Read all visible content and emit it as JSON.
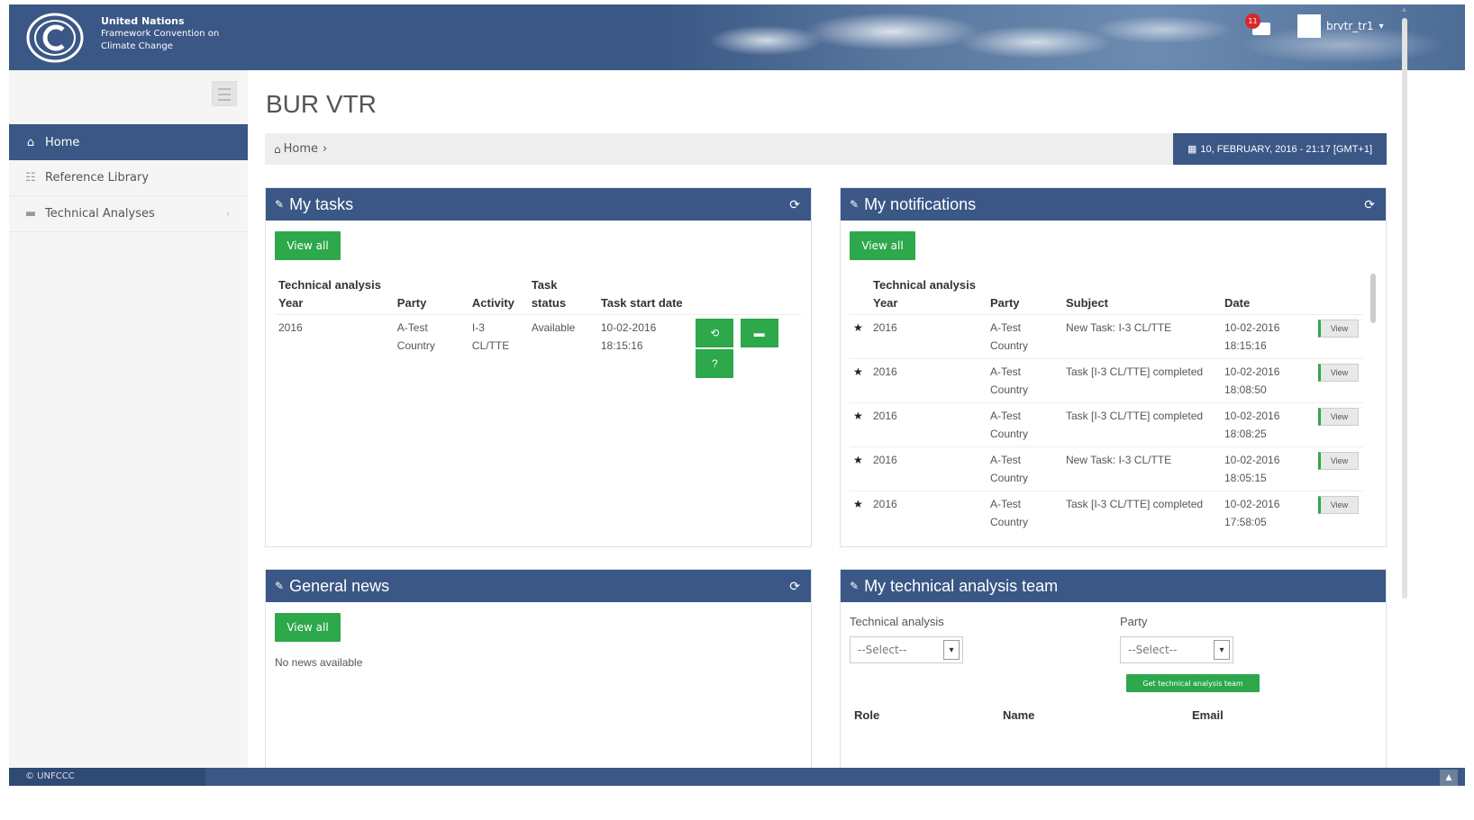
{
  "header": {
    "org_line1": "United Nations",
    "org_line2": "Framework Convention on",
    "org_line3": "Climate Change",
    "notification_count": "11",
    "username": "brvtr_tr1"
  },
  "sidebar": {
    "items": [
      {
        "label": "Home",
        "icon": "home-icon"
      },
      {
        "label": "Reference Library",
        "icon": "list-icon"
      },
      {
        "label": "Technical Analyses",
        "icon": "folder-icon"
      }
    ]
  },
  "main": {
    "title": "BUR VTR",
    "breadcrumb": "Home",
    "datetime": "10, FEBRUARY, 2016 - 21:17 [GMT+1]"
  },
  "my_tasks": {
    "title": "My tasks",
    "view_all": "View all",
    "headers": [
      "Technical analysis Year",
      "Party",
      "Activity",
      "Task status",
      "Task start date"
    ],
    "rows": [
      {
        "year": "2016",
        "party": "A-Test Country",
        "activity": "I-3 CL/TTE",
        "status": "Available",
        "start": "10-02-2016 18:15:16"
      }
    ],
    "help_label": "?"
  },
  "my_notifications": {
    "title": "My notifications",
    "view_all": "View all",
    "headers": [
      "Technical analysis Year",
      "Party",
      "Subject",
      "Date"
    ],
    "view_label": "View",
    "rows": [
      {
        "year": "2016",
        "party": "A-Test Country",
        "subject": "New Task: I-3 CL/TTE",
        "date": "10-02-2016 18:15:16"
      },
      {
        "year": "2016",
        "party": "A-Test Country",
        "subject": "Task [I-3 CL/TTE] completed",
        "date": "10-02-2016 18:08:50"
      },
      {
        "year": "2016",
        "party": "A-Test Country",
        "subject": "Task [I-3 CL/TTE] completed",
        "date": "10-02-2016 18:08:25"
      },
      {
        "year": "2016",
        "party": "A-Test Country",
        "subject": "New Task: I-3 CL/TTE",
        "date": "10-02-2016 18:05:15"
      },
      {
        "year": "2016",
        "party": "A-Test Country",
        "subject": "Task [I-3 CL/TTE] completed",
        "date": "10-02-2016 17:58:05"
      }
    ]
  },
  "general_news": {
    "title": "General news",
    "view_all": "View all",
    "empty": "No news available"
  },
  "team": {
    "title": "My technical analysis team",
    "ta_label": "Technical analysis",
    "party_label": "Party",
    "select_placeholder": "--Select--",
    "get_button": "Get technical analysis team",
    "headers": [
      "Role",
      "Name",
      "Email"
    ]
  },
  "footer": {
    "copyright": "© UNFCCC"
  },
  "colors": {
    "primary": "#3a5785",
    "success": "#2da84a",
    "badge": "#d9262b"
  }
}
